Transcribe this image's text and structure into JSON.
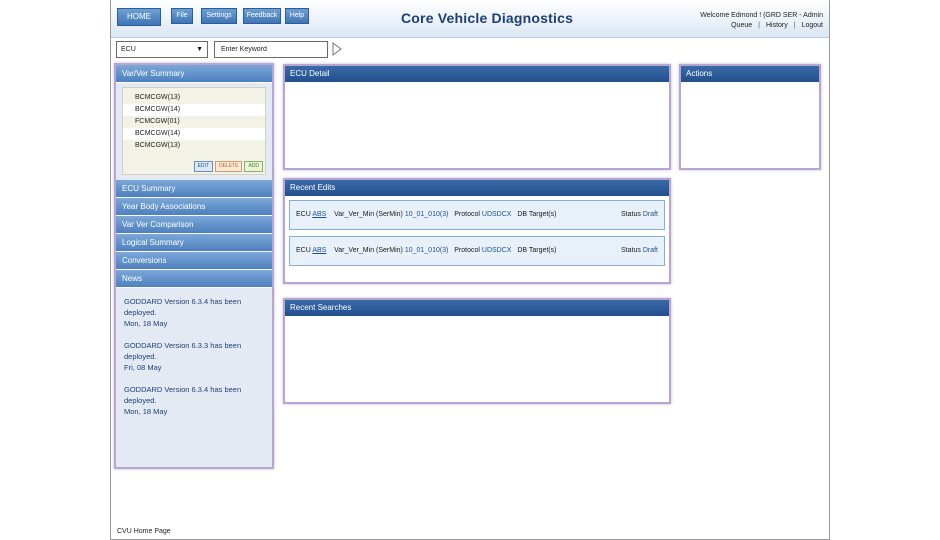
{
  "header": {
    "nav": [
      "HOME",
      "File",
      "Settings",
      "Feedback",
      "Help"
    ],
    "title": "Core Vehicle Diagnostics",
    "welcome": "Welcome Edmond !  (GRD SER - Admin",
    "links": [
      "Queue",
      "History",
      "Logout"
    ]
  },
  "search": {
    "ecu_value": "ECU",
    "keyword_placeholder": "Enter Keyword"
  },
  "left": {
    "var_ver_title": "Var/Ver Summary",
    "var_items": [
      "BCMCGW(13)",
      "BCMCGW(14)",
      "FCMCGW(01)",
      "BCMCGW(14)",
      "BCMCGW(13)"
    ],
    "buttons": {
      "edit": "EDIT",
      "delete": "DELETE",
      "add": "ADD"
    },
    "menu": [
      "ECU Summary",
      "Year Body Associations",
      "Var Ver Comparison",
      "Logical Summary",
      "Conversions",
      "News"
    ],
    "news": [
      {
        "text": "GODDARD Version 6.3.4 has been deployed.",
        "date": "Mon, 18 May"
      },
      {
        "text": "GODDARD Version 6.3.3 has been deployed.",
        "date": "Fri, 08 May"
      },
      {
        "text": "GODDARD Version 6.3.4 has been deployed.",
        "date": "Mon, 18 May"
      }
    ]
  },
  "panels": {
    "ecu_detail": "ECU Detail",
    "actions": "Actions",
    "recent_edits": "Recent Edits",
    "recent_searches": "Recent Searches"
  },
  "edits": [
    {
      "ecu_label": "ECU",
      "ecu": "ABS",
      "var_label": "Var_Ver_Min (SerMin)",
      "var": "10_01_010(3)",
      "proto_label": "Protocol",
      "proto": "UDSDCX",
      "db": "DB Target(s)",
      "status_label": "Status",
      "status": "Draft"
    },
    {
      "ecu_label": "ECU",
      "ecu": "ABS",
      "var_label": "Var_Ver_Min (SerMin)",
      "var": "10_01_010(3)",
      "proto_label": "Protocol",
      "proto": "UDSDCX",
      "db": "DB Target(s)",
      "status_label": "Status",
      "status": "Draft"
    }
  ],
  "footer": "CVU Home Page"
}
